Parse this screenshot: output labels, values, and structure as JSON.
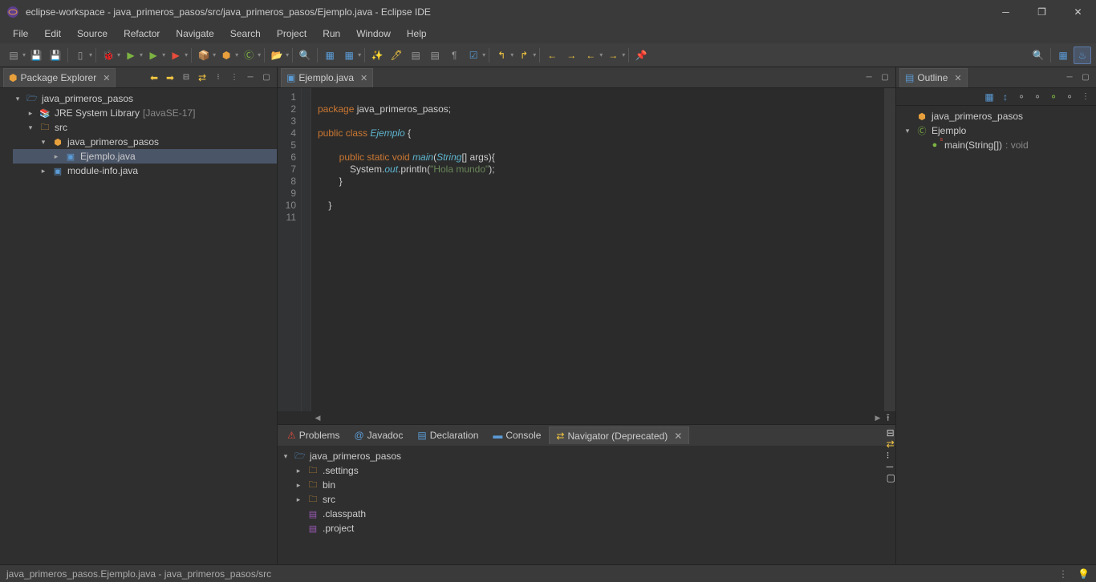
{
  "window": {
    "title": "eclipse-workspace - java_primeros_pasos/src/java_primeros_pasos/Ejemplo.java - Eclipse IDE"
  },
  "menu": [
    "File",
    "Edit",
    "Source",
    "Refactor",
    "Navigate",
    "Search",
    "Project",
    "Run",
    "Window",
    "Help"
  ],
  "packageExplorer": {
    "title": "Package Explorer",
    "project": "java_primeros_pasos",
    "jre": "JRE System Library",
    "jreVersion": "[JavaSE-17]",
    "src": "src",
    "package": "java_primeros_pasos",
    "file1": "Ejemplo.java",
    "file2": "module-info.java"
  },
  "editor": {
    "tab": "Ejemplo.java",
    "lines": [
      "1",
      "2",
      "3",
      "4",
      "5",
      "6",
      "7",
      "8",
      "9",
      "10",
      "11"
    ],
    "code": {
      "l1_kw": "package",
      "l1_rest": " java_primeros_pasos;",
      "l3_kw": "public class ",
      "l3_name": "Ejemplo",
      "l3_rest": " {",
      "l5_kw1": "public static void ",
      "l5_name": "main",
      "l5_paren": "(",
      "l5_type": "String",
      "l5_rest": "[] args){",
      "l6_pre": "            System.",
      "l6_field": "out",
      "l6_mid": ".println(",
      "l6_str": "\"Hola mundo\"",
      "l6_end": ");",
      "l7": "        }",
      "l9": "    }",
      "indent5": "        ",
      "indent6": ""
    }
  },
  "outline": {
    "title": "Outline",
    "package": "java_primeros_pasos",
    "class": "Ejemplo",
    "method": "main(String[])",
    "methodType": " : void"
  },
  "bottomTabs": [
    "Problems",
    "Javadoc",
    "Declaration",
    "Console",
    "Navigator (Deprecated)"
  ],
  "navigator": {
    "project": "java_primeros_pasos",
    "settings": ".settings",
    "bin": "bin",
    "src": "src",
    "classpath": ".classpath",
    "projectFile": ".project"
  },
  "statusbar": {
    "text": "java_primeros_pasos.Ejemplo.java - java_primeros_pasos/src"
  }
}
